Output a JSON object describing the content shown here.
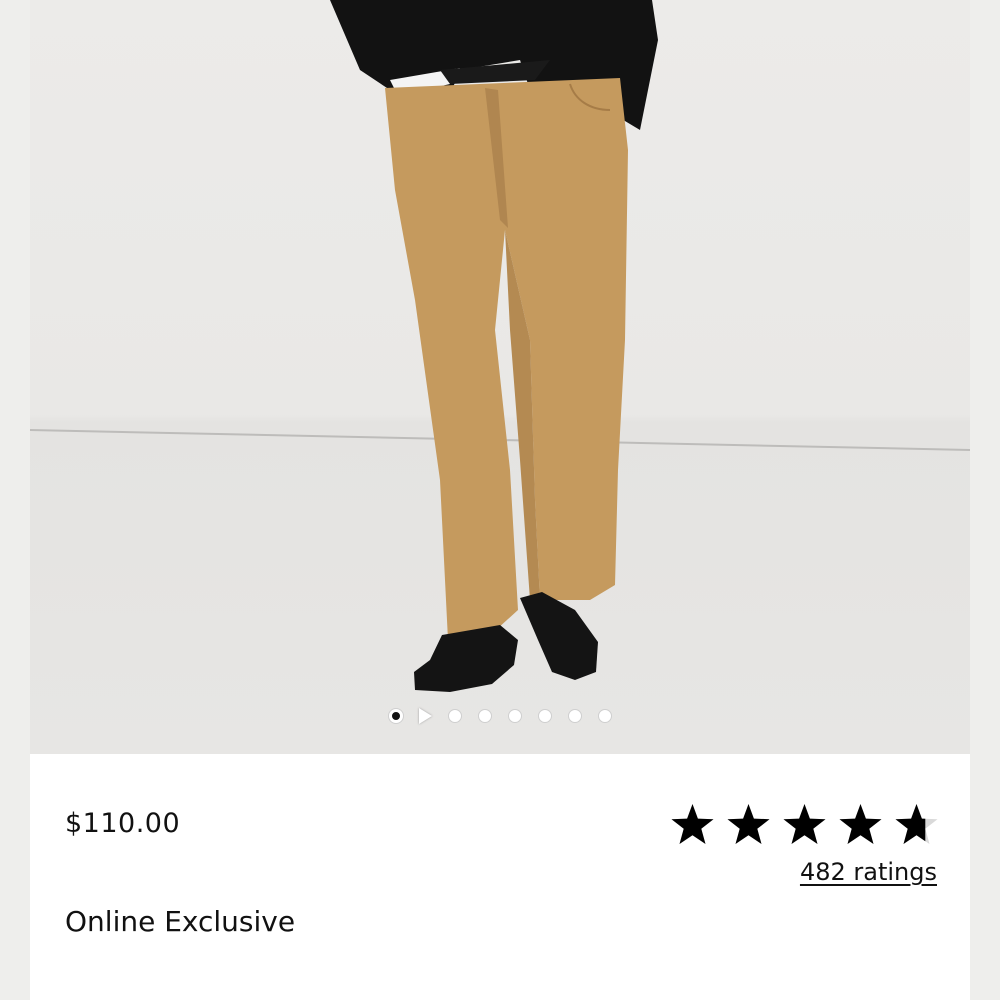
{
  "product": {
    "image_alt": "Khaki five-pocket pants on model with black jacket and black loafers",
    "price": "$110.00",
    "badge": "Online Exclusive",
    "rating": 4.7,
    "rating_max": 5,
    "ratings_count_label": "482 ratings"
  },
  "gallery": {
    "current_index": 0,
    "total_slides": 8,
    "has_video": true
  },
  "colors": {
    "pants": "#c59a5e",
    "shoes": "#141414",
    "jacket": "#121212",
    "star": "#000000"
  }
}
